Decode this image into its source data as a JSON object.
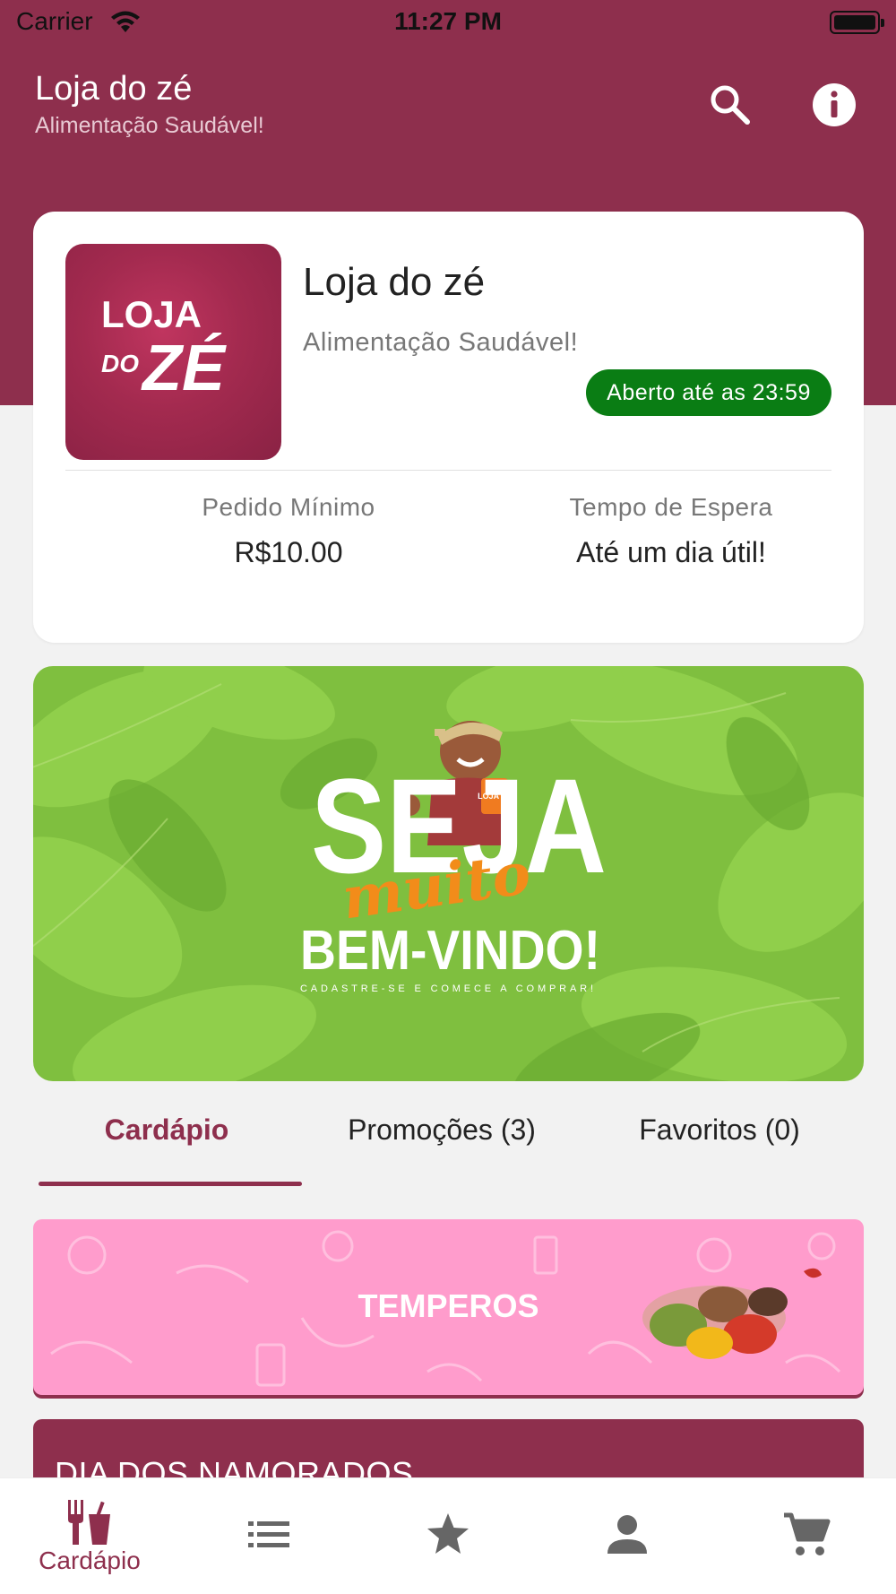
{
  "status_bar": {
    "carrier": "Carrier",
    "time": "11:27 PM"
  },
  "app_bar": {
    "title": "Loja do zé",
    "subtitle": "Alimentação Saudável!"
  },
  "store": {
    "logo_text_1": "LOJA",
    "logo_text_2": "DO",
    "logo_text_3": "ZÉ",
    "name": "Loja do zé",
    "description": "Alimentação Saudável!",
    "open_badge": "Aberto até as 23:59",
    "min_order_label": "Pedido Mínimo",
    "min_order_value": "R$10.00",
    "wait_label": "Tempo de Espera",
    "wait_value": "Até um dia útil!"
  },
  "banner": {
    "line1": "SEJA",
    "line2": "muito",
    "line3": "BEM-VINDO!",
    "line4": "CADASTRE-SE E COMECE A COMPRAR!",
    "cup_text": "LOJA ZÉ"
  },
  "tabs": [
    {
      "label": "Cardápio",
      "active": true
    },
    {
      "label": "Promoções (3)",
      "active": false
    },
    {
      "label": "Favoritos (0)",
      "active": false
    }
  ],
  "categories": [
    {
      "title": "TEMPEROS"
    },
    {
      "title": "DIA DOS NAMORADOS"
    }
  ],
  "bottom_nav": [
    {
      "icon": "restaurant-icon",
      "label": "Cardápio",
      "active": true
    },
    {
      "icon": "list-icon",
      "label": ""
    },
    {
      "icon": "star-icon",
      "label": ""
    },
    {
      "icon": "person-icon",
      "label": ""
    },
    {
      "icon": "cart-icon",
      "label": ""
    }
  ],
  "colors": {
    "primary": "#8e2f4d",
    "open_badge": "#0a7d14",
    "category_pink": "#ff9ccc",
    "banner_green": "#7fbf3f"
  }
}
